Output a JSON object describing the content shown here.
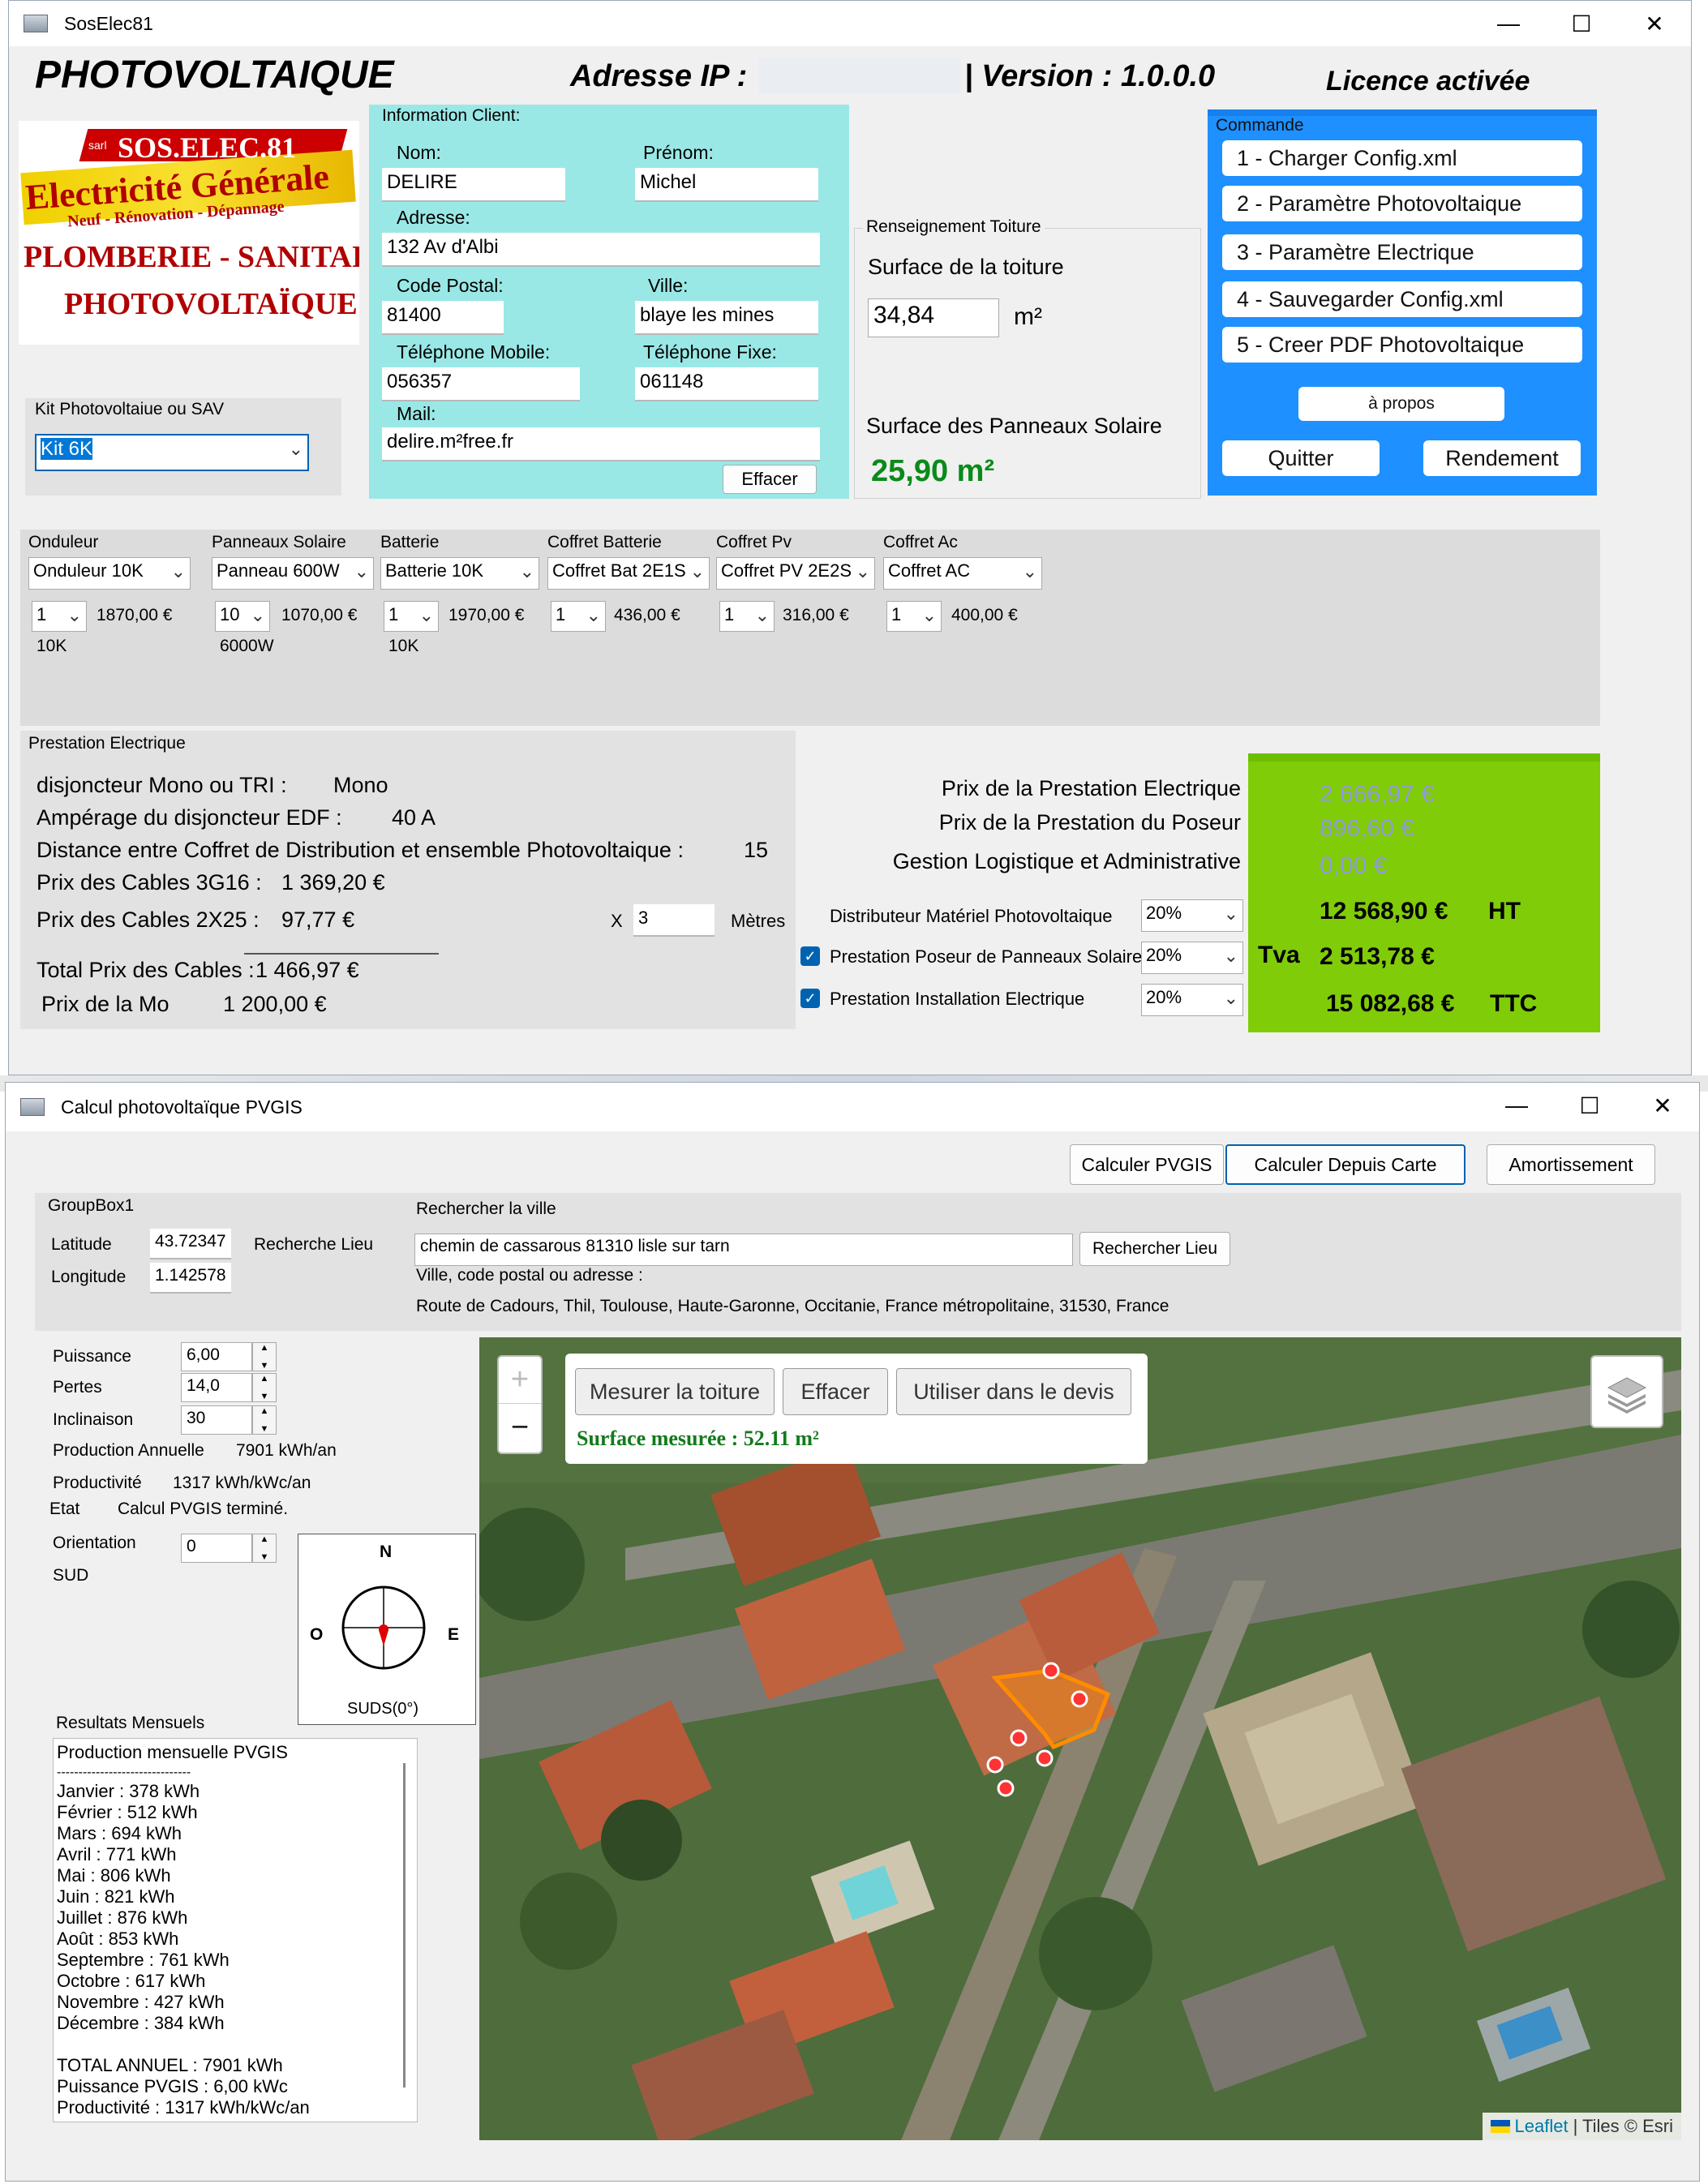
{
  "win1": {
    "title": "SosElec81",
    "app_heading": "PHOTOVOLTAIQUE",
    "ip_label": "Adresse IP :",
    "version": "| Version : 1.0.0.0",
    "licence": "Licence activée",
    "logo": {
      "sarl": "sarl",
      "brand": "SOS.ELEC.81",
      "line1": "Electricité Générale",
      "line2": "Neuf - Rénovation - Dépannage",
      "line3": "PLOMBERIE - SANITAIRE",
      "line4": "PHOTOVOLTAÏQUE"
    },
    "kit": {
      "group": "Kit Photovoltaiue ou SAV",
      "value": "Kit 6K"
    },
    "client": {
      "group": "Information Client:",
      "nom_label": "Nom:",
      "nom": "DELIRE",
      "prenom_label": "Prénom:",
      "prenom": "Michel",
      "adresse_label": "Adresse:",
      "adresse": "132 Av d'Albi",
      "cp_label": "Code Postal:",
      "cp": "81400",
      "ville_label": "Ville:",
      "ville": "blaye les mines",
      "mobile_label": "Téléphone Mobile:",
      "mobile": "056357",
      "fixe_label": "Téléphone Fixe:",
      "fixe": "061148",
      "mail_label": "Mail:",
      "mail": "delire.m²free.fr",
      "effacer": "Effacer"
    },
    "toiture": {
      "group": "Renseignement Toiture",
      "surface_label": "Surface de la toiture",
      "surface": "34,84",
      "unit": "m²",
      "panneaux_label": "Surface  des Panneaux Solaire",
      "panneaux_value": "25,90 m²"
    },
    "commande": {
      "group": "Commande",
      "b1": "1 - Charger Config.xml",
      "b2": "2 - Paramètre Photovoltaique",
      "b3": "3 - Paramètre Electrique",
      "b4": "4 - Sauvegarder Config.xml",
      "b5": "5 - Creer PDF Photovoltaique",
      "apropos": "à propos",
      "quitter": "Quitter",
      "rendement": "Rendement"
    },
    "materiel": [
      {
        "label": "Onduleur",
        "select": "Onduleur 10K",
        "qty": "1",
        "price": "1870,00 €",
        "sub": "10K"
      },
      {
        "label": "Panneaux Solaire",
        "select": "Panneau 600W",
        "qty": "10",
        "price": "1070,00 €",
        "sub": "6000W"
      },
      {
        "label": "Batterie",
        "select": "Batterie 10K",
        "qty": "1",
        "price": "1970,00 €",
        "sub": "10K"
      },
      {
        "label": "Coffret Batterie",
        "select": "Coffret Bat 2E1S",
        "qty": "1",
        "price": "436,00 €",
        "sub": ""
      },
      {
        "label": "Coffret Pv",
        "select": "Coffret PV 2E2S",
        "qty": "1",
        "price": "316,00 €",
        "sub": ""
      },
      {
        "label": "Coffret Ac",
        "select": "Coffret AC",
        "qty": "1",
        "price": "400,00 €",
        "sub": ""
      }
    ],
    "prestation": {
      "group": "Prestation Electrique",
      "disj_label": "disjoncteur Mono ou TRI :",
      "disj_value": "Mono",
      "amp_label": "Ampérage du disjoncteur EDF :",
      "amp_value": "40 A",
      "dist_label": "Distance entre Coffret de Distribution et ensemble Photovoltaique :",
      "dist_value": "15",
      "cable1_label": "Prix des Cables 3G16 :",
      "cable1_value": "1 369,20 €",
      "cable2_label": "Prix des Cables 2X25 :",
      "cable2_value": "97,77 €",
      "x_label": "X",
      "metres_value": "3",
      "metres_label": "Mètres",
      "total_label": "Total Prix des Cables :",
      "total_value": "1 466,97 €",
      "mo_label": "Prix de la Mo",
      "mo_value": "1 200,00 €"
    },
    "prix": {
      "elec_label": "Prix de la Prestation Electrique",
      "poseur_label": "Prix de la Prestation du Poseur",
      "gestion_label": "Gestion Logistique et Administrative",
      "distrib_label": "Distributeur Matériel Photovoltaique",
      "distrib_pct": "20%",
      "poseur_chk_label": "Prestation Poseur de Panneaux Solaire",
      "poseur_pct": "20%",
      "install_chk_label": "Prestation Installation Electrique",
      "install_pct": "20%",
      "elec_value": "2 666,97 €",
      "poseur_value": "896,60 €",
      "gestion_value": "0,00 €",
      "ht_value": "12 568,90 €",
      "ht_label": "HT",
      "tva_label": "Tva",
      "tva_value": "2 513,78 €",
      "ttc_value": "15 082,68 €",
      "ttc_label": "TTC"
    }
  },
  "win2": {
    "title": "Calcul photovoltaïque PVGIS",
    "btn_pvgis": "Calculer PVGIS",
    "btn_carte": "Calculer Depuis Carte",
    "btn_amort": "Amortissement",
    "group1": "GroupBox1",
    "lat_label": "Latitude",
    "lat": "43.72347",
    "lon_label": "Longitude",
    "lon": "1.142578",
    "recherche_label": "Recherche Lieu",
    "search_group": "Rechercher la ville",
    "search_value": "chemin de cassarous 81310 lisle sur tarn",
    "search_btn": "Rechercher Lieu",
    "ville_hint": "Ville, code postal ou adresse :",
    "ville_result": "Route de Cadours, Thil, Toulouse, Haute-Garonne, Occitanie, France métropolitaine, 31530, France",
    "puissance_label": "Puissance",
    "puissance": "6,00",
    "pertes_label": "Pertes",
    "pertes": "14,0",
    "incl_label": "Inclinaison",
    "incl": "30",
    "prod_label": "Production Annuelle",
    "prod_value": "7901 kWh/an",
    "productivite_label": "Productivité",
    "productivite_value": "1317 kWh/kWc/an",
    "etat_label": "Etat",
    "etat_value": "Calcul PVGIS terminé.",
    "orient_label": "Orientation",
    "orient": "0",
    "sud": "SUD",
    "compass": {
      "n": "N",
      "e": "E",
      "o": "O",
      "caption": "SUDS(0°)"
    },
    "results_group": "Resultats Mensuels",
    "results_title": "Production mensuelle PVGIS",
    "results_sep": "-------------------------------",
    "months": [
      "Janvier : 378 kWh",
      "Février : 512 kWh",
      "Mars : 694 kWh",
      "Avril : 771 kWh",
      "Mai : 806 kWh",
      "Juin : 821 kWh",
      "Juillet : 876 kWh",
      "Août : 853 kWh",
      "Septembre : 761 kWh",
      "Octobre : 617 kWh",
      "Novembre : 427 kWh",
      "Décembre : 384 kWh"
    ],
    "total": "TOTAL ANNUEL : 7901 kWh",
    "puissance_pvgis": "Puissance PVGIS : 6,00 kWc",
    "productivite_line": "Productivité : 1317 kWh/kWc/an",
    "map": {
      "zoom_in": "+",
      "zoom_out": "−",
      "measure": "Mesurer la toiture",
      "effacer": "Effacer",
      "utiliser": "Utiliser dans le devis",
      "surface": "Surface mesurée : 52.11 m²",
      "attribution_leaflet": "Leaflet",
      "attribution_tiles": "| Tiles © Esri"
    }
  }
}
